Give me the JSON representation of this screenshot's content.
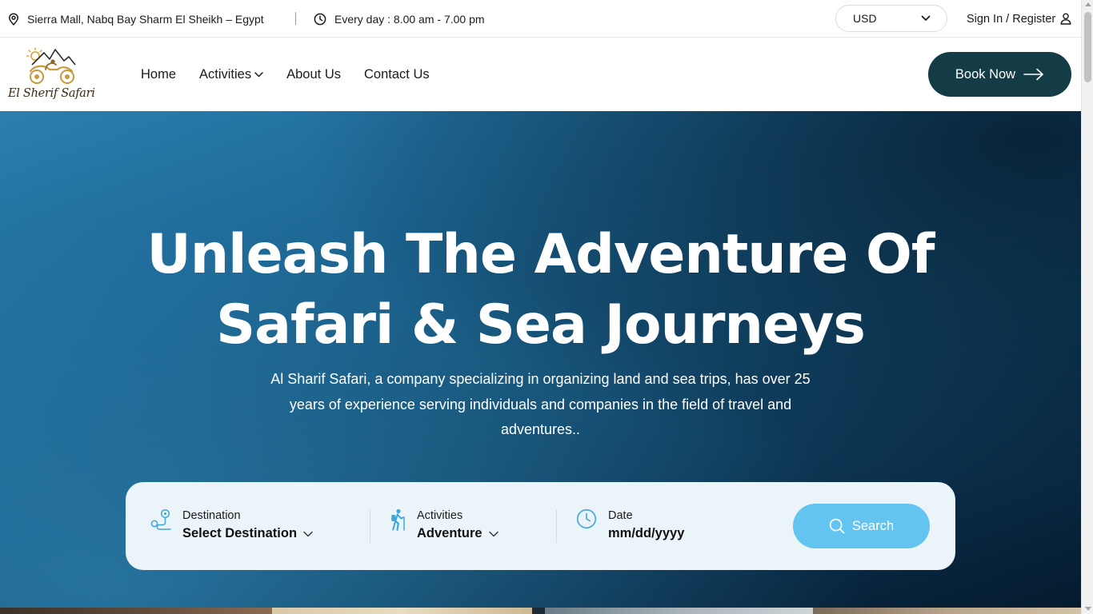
{
  "topbar": {
    "location": "Sierra Mall, Nabq Bay Sharm El Sheikh – Egypt",
    "hours": "Every day : 8.00 am - 7.00 pm",
    "currency": "USD",
    "signin": "Sign In / Register"
  },
  "brand": {
    "name": "El Sherif Safari"
  },
  "nav": {
    "items": [
      "Home",
      "Activities",
      "About Us",
      "Contact Us"
    ],
    "book_label": "Book Now"
  },
  "hero": {
    "title_line1": "Unleash The Adventure Of",
    "title_line2": "Safari & Sea Journeys",
    "description": "Al Sharif Safari, a company specializing in organizing land and sea trips, has over 25 years of experience serving individuals and companies in the field of travel and adventures.."
  },
  "search": {
    "destination_label": "Destination",
    "destination_value": "Select Destination",
    "activities_label": "Activities",
    "activities_value": "Adventure",
    "date_label": "Date",
    "date_value": "mm/dd/yyyy",
    "button_label": "Search"
  },
  "colors": {
    "primary_dark": "#143c46",
    "accent": "#63c4f0",
    "search_bg": "#eaf4f9",
    "hero_light": "#2a7fb0",
    "hero_dark": "#041a2d"
  },
  "icons": [
    "map-pin-icon",
    "clock-icon",
    "chevron-down-icon",
    "user-icon",
    "arrow-right-icon",
    "route-icon",
    "hiker-icon",
    "search-icon"
  ]
}
